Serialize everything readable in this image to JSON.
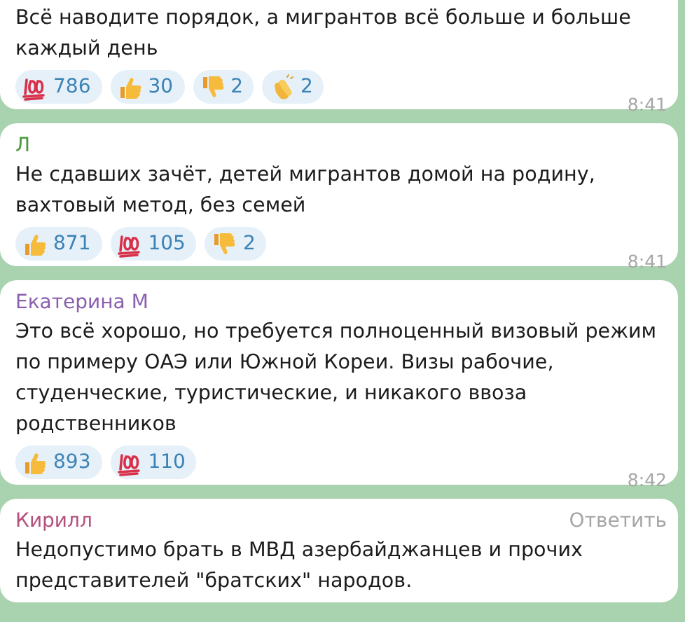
{
  "messages": [
    {
      "text": "Всё наводите порядок, а мигрантов всё больше и больше каждый день",
      "reactions": [
        {
          "kind": "hundred",
          "count": "786"
        },
        {
          "kind": "thumbs_up",
          "count": "30"
        },
        {
          "kind": "thumbs_down",
          "count": "2"
        },
        {
          "kind": "clap",
          "count": "2"
        }
      ],
      "time": "8:41"
    },
    {
      "author": "Л",
      "color": "#4a9a3c",
      "text": "Не сдавших зачёт, детей мигрантов домой на родину, вахтовый метод, без семей",
      "reactions": [
        {
          "kind": "thumbs_up",
          "count": "871"
        },
        {
          "kind": "hundred",
          "count": "105"
        },
        {
          "kind": "thumbs_down",
          "count": "2"
        }
      ],
      "time": "8:41"
    },
    {
      "author": "Екатерина М",
      "color": "#8a5fae",
      "text": "Это всё хорошо, но требуется полноценный визовый режим по примеру ОАЭ или Южной Кореи. Визы рабочие, студенческие, туристические, и никакого ввоза родственников",
      "reactions": [
        {
          "kind": "thumbs_up",
          "count": "893"
        },
        {
          "kind": "hundred",
          "count": "110"
        }
      ],
      "time": "8:42"
    },
    {
      "author": "Кирилл",
      "color": "#b5507e",
      "reply_label": "Ответить",
      "text": "Недопустимо брать в МВД азербайджанцев и прочих представителей \"братских\" народов."
    }
  ]
}
